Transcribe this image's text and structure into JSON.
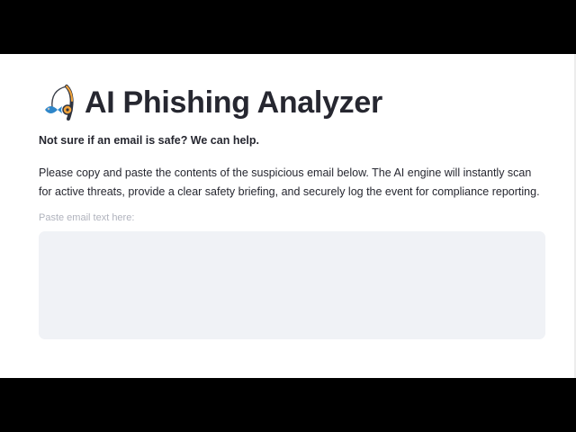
{
  "app": {
    "title": "AI Phishing Analyzer",
    "title_icon": "fishing-pole-icon",
    "subtitle": "Not sure if an email is safe? We can help.",
    "description": "Please copy and paste the contents of the suspicious email below. The AI engine will instantly scan for active threats, provide a clear safety briefing, and securely log the event for compliance reporting.",
    "email_input": {
      "label": "Paste email text here:",
      "value": "",
      "placeholder": ""
    }
  },
  "colors": {
    "text": "#262730",
    "label": "#b0b3bd",
    "input_background": "#f0f2f6",
    "background": "#ffffff"
  }
}
